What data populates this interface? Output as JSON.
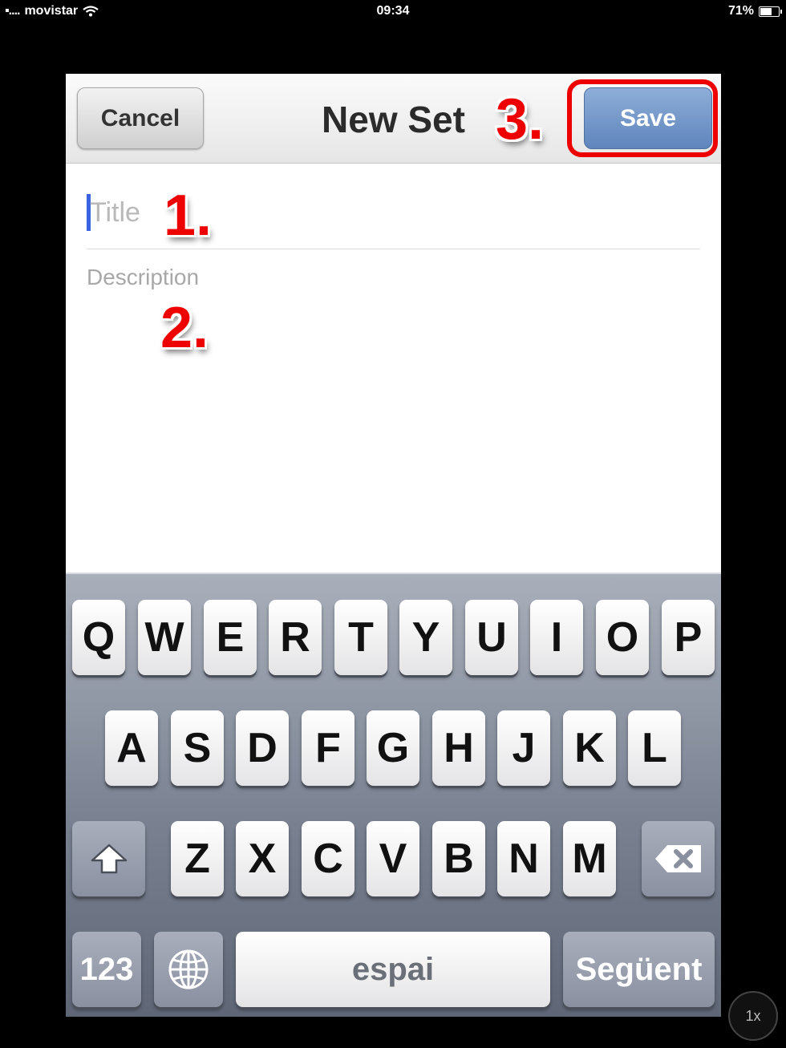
{
  "status_bar": {
    "carrier": "movistar",
    "time": "09:34",
    "battery": "71%",
    "battery_level": 0.71
  },
  "navbar": {
    "title": "New Set",
    "cancel_label": "Cancel",
    "save_label": "Save"
  },
  "form": {
    "title_placeholder": "Title",
    "description_placeholder": "Description"
  },
  "annotations": {
    "step1": "1.",
    "step2": "2.",
    "step3": "3."
  },
  "keyboard": {
    "row1": [
      "Q",
      "W",
      "E",
      "R",
      "T",
      "Y",
      "U",
      "I",
      "O",
      "P"
    ],
    "row2": [
      "A",
      "S",
      "D",
      "F",
      "G",
      "H",
      "J",
      "K",
      "L"
    ],
    "row3": [
      "Z",
      "X",
      "C",
      "V",
      "B",
      "N",
      "M"
    ],
    "numbers_label": "123",
    "space_label": "espai",
    "next_label": "Següent"
  },
  "zoom_label": "1x",
  "colors": {
    "save_button": "#6f92c8",
    "annotation_red": "#e00000",
    "cursor": "#3b62e0"
  }
}
